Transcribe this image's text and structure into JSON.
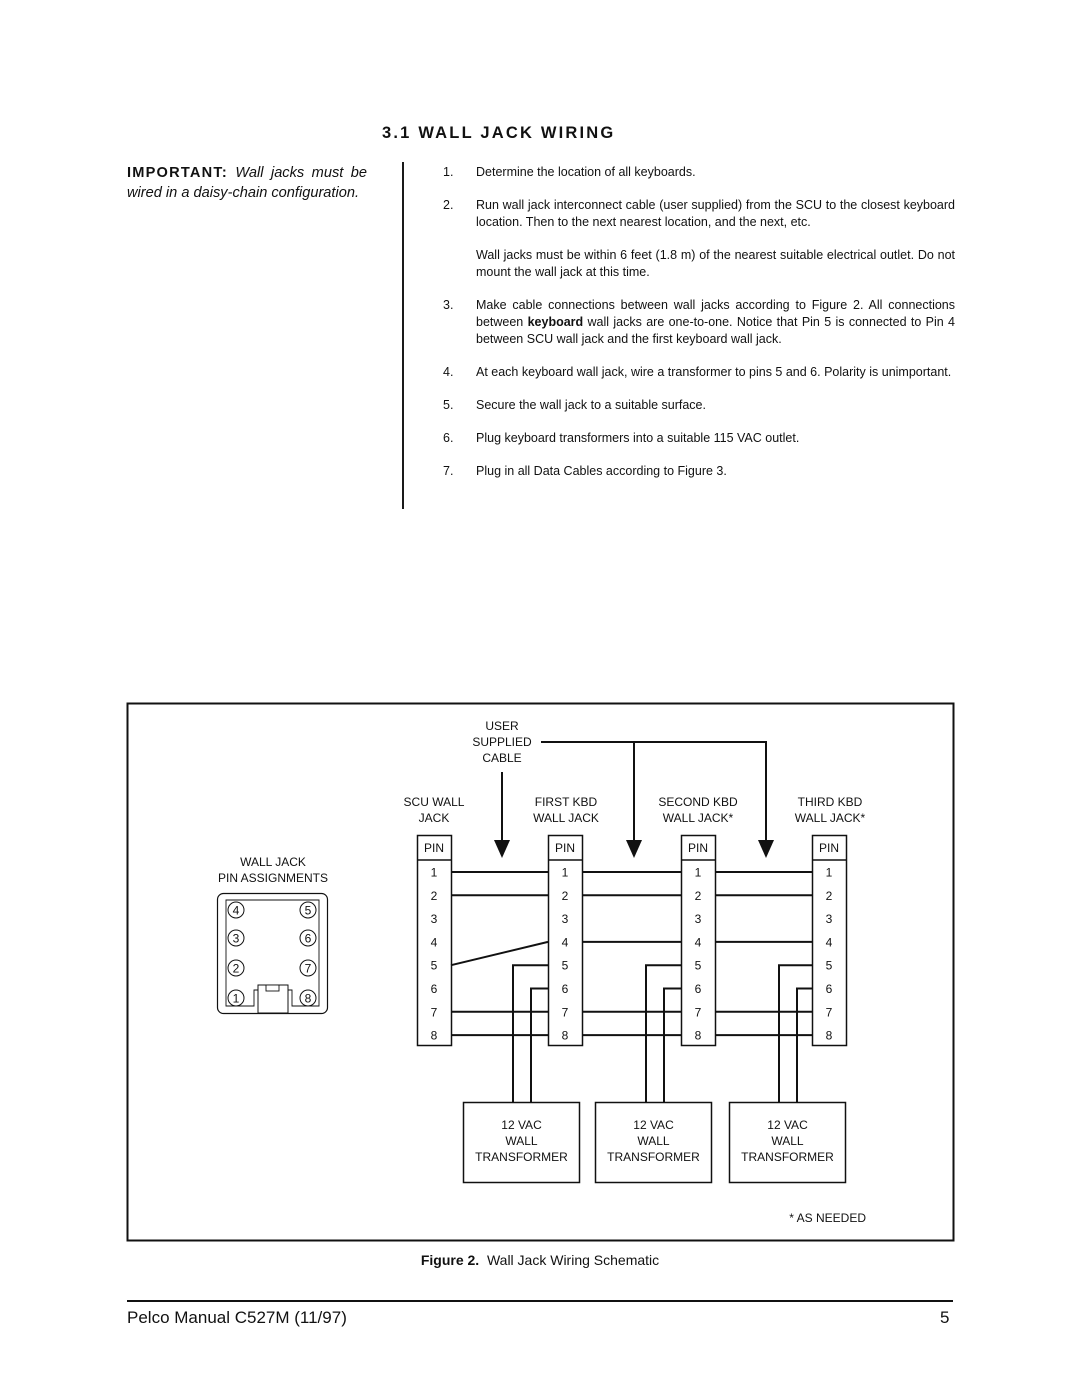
{
  "section": {
    "heading": "3.1  WALL JACK WIRING",
    "important_label": "IMPORTANT:",
    "important_text": "Wall jacks must be wired in a daisy-chain configuration.",
    "steps": [
      {
        "num": "1.",
        "text": "Determine the location of all keyboards."
      },
      {
        "num": "2.",
        "text": "Run wall jack interconnect cable (user supplied) from the SCU to the closest keyboard location. Then to the next nearest location, and the next, etc.",
        "sub": "Wall jacks must be within 6 feet (1.8 m) of the nearest suitable electrical outlet. Do not mount the wall jack at this time."
      },
      {
        "num": "3.",
        "text_before": "Make cable connections between wall jacks according to Figure 2. All connections between ",
        "bold": "keyboard",
        "text_after": " wall jacks are one-to-one. Notice that Pin 5 is connected to Pin 4 between SCU wall jack and the first keyboard wall jack."
      },
      {
        "num": "4.",
        "text": "At each keyboard wall jack, wire a transformer to pins 5 and 6. Polarity is unimportant."
      },
      {
        "num": "5.",
        "text": "Secure the wall jack to a suitable surface."
      },
      {
        "num": "6.",
        "text": "Plug keyboard transformers into a suitable 115 VAC outlet."
      },
      {
        "num": "7.",
        "text": "Plug in all Data Cables according to Figure 3."
      }
    ]
  },
  "figure": {
    "cable_label": [
      "USER",
      "SUPPLIED",
      "CABLE"
    ],
    "pin_assign_title": [
      "WALL JACK",
      "PIN ASSIGNMENTS"
    ],
    "pin_assign_layout": {
      "left": [
        "4",
        "3",
        "2",
        "1"
      ],
      "right": [
        "5",
        "6",
        "7",
        "8"
      ]
    },
    "jacks": [
      {
        "label": [
          "SCU WALL",
          "JACK"
        ],
        "header": "PIN",
        "pins": [
          "1",
          "2",
          "3",
          "4",
          "5",
          "6",
          "7",
          "8"
        ]
      },
      {
        "label": [
          "FIRST KBD",
          "WALL JACK"
        ],
        "header": "PIN",
        "pins": [
          "1",
          "2",
          "3",
          "4",
          "5",
          "6",
          "7",
          "8"
        ]
      },
      {
        "label": [
          "SECOND KBD",
          "WALL JACK*"
        ],
        "header": "PIN",
        "pins": [
          "1",
          "2",
          "3",
          "4",
          "5",
          "6",
          "7",
          "8"
        ]
      },
      {
        "label": [
          "THIRD KBD",
          "WALL JACK*"
        ],
        "header": "PIN",
        "pins": [
          "1",
          "2",
          "3",
          "4",
          "5",
          "6",
          "7",
          "8"
        ]
      }
    ],
    "connections": [
      {
        "from_jack": 0,
        "to_jack": 1,
        "pairs": [
          [
            1,
            1
          ],
          [
            2,
            2
          ],
          [
            5,
            4
          ],
          [
            7,
            7
          ],
          [
            8,
            8
          ]
        ]
      },
      {
        "from_jack": 1,
        "to_jack": 2,
        "pairs": [
          [
            1,
            1
          ],
          [
            2,
            2
          ],
          [
            4,
            4
          ],
          [
            7,
            7
          ],
          [
            8,
            8
          ]
        ]
      },
      {
        "from_jack": 2,
        "to_jack": 3,
        "pairs": [
          [
            1,
            1
          ],
          [
            2,
            2
          ],
          [
            4,
            4
          ],
          [
            7,
            7
          ],
          [
            8,
            8
          ]
        ]
      }
    ],
    "transformer_pins": [
      5,
      6
    ],
    "transformers": [
      {
        "lines": [
          "12 VAC",
          "WALL",
          "TRANSFORMER"
        ]
      },
      {
        "lines": [
          "12 VAC",
          "WALL",
          "TRANSFORMER"
        ]
      },
      {
        "lines": [
          "12 VAC",
          "WALL",
          "TRANSFORMER"
        ]
      }
    ],
    "footnote": "* AS NEEDED",
    "caption_label": "Figure 2.",
    "caption_text": "Wall Jack Wiring Schematic"
  },
  "footer": {
    "manual": "Pelco Manual C527M (11/97)",
    "page": "5"
  }
}
